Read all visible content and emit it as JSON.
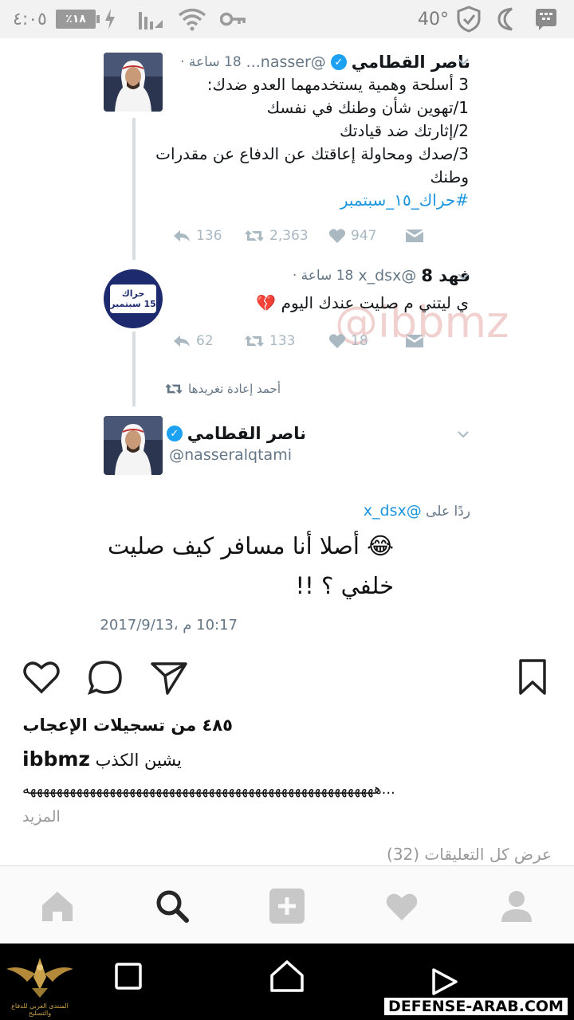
{
  "status_bar": {
    "clock": "٤:٠٥",
    "battery": "٪١٨",
    "temperature": "40°"
  },
  "tweet1": {
    "name": "ناصر القطامي",
    "handle": "@nasser...",
    "time": "18 ساعة ·",
    "lines": [
      "3 أسلحة وهمية يستخدمهما العدو ضدك:",
      "1/تهوين شأن وطنك في نفسك",
      "2/إثارتك ضد قيادتك",
      "3/صدك ومحاولة إعاقتك عن الدفاع عن مقدرات",
      "وطنك"
    ],
    "hashtag": "#حراك_١٥_سبتمبر",
    "replies": "136",
    "retweets": "2,363",
    "likes": "947"
  },
  "tweet2": {
    "name": "فهد 8",
    "handle": "@x_dsx",
    "time": "18 ساعة ·",
    "text": "ي ليتني م صليت عندك اليوم 💔",
    "avatar_line1": "حراك",
    "avatar_line2": "15 سبتمبر",
    "replies": "62",
    "retweets": "133",
    "likes": "18",
    "watermark": "@ibbmz"
  },
  "retweeted_by": "أحمد إعادة تغريدها",
  "tweet3": {
    "name": "ناصر القطامي",
    "handle": "@nasseralqtami",
    "reply_prefix": "ردًا على",
    "reply_handle": "@x_dsx",
    "line1": "😂 أصلا أنا مسافر كيف صليت",
    "line2": "خلفي ؟ !!",
    "date": "10:17 م ،2017/9/13"
  },
  "post": {
    "likes": "٤٨٥ من تسجيلات الإعجاب",
    "username": "ibbmz",
    "caption": "يشين الكذب",
    "caption_line2": "هههههههههههههههههههههههههههههههههههههههههههههههههههههه...",
    "more": "المزيد",
    "view_comments": "عرض كل التعليقات (32)"
  },
  "watermark_site": "DEFENSE-ARAB.COM",
  "logo_text": "المنتدى العربي للدفاع والتسليح",
  "colors": {
    "link_blue": "#1b95e0",
    "verified_blue": "#1da1f2",
    "muted_grey": "#657786",
    "icon_grey": "#aab8c2",
    "tab_icon_grey": "#c8c8c8"
  }
}
